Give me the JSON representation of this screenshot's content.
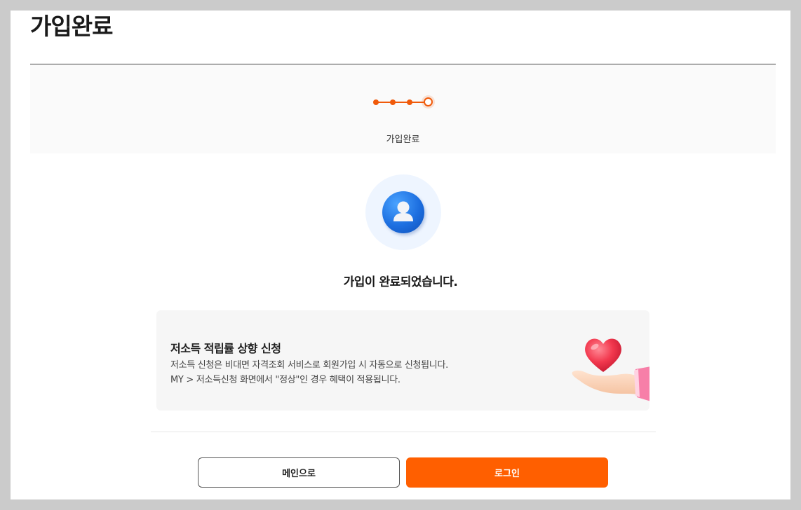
{
  "page": {
    "title": "가입완료"
  },
  "stepper": {
    "total_steps": 4,
    "current_step": 4,
    "current_label": "가입완료",
    "accent_color": "#f05a0a"
  },
  "result": {
    "icon": "user-avatar-icon",
    "message": "가입이 완료되었습니다."
  },
  "info_card": {
    "title": "저소득 적립률 상향 신청",
    "line1": "저소득 신청은 비대면 자격조회 서비스로 회원가입 시 자동으로 신청됩니다.",
    "line2": "MY > 저소득신청 화면에서 \"정상\"인 경우 혜택이 적용됩니다.",
    "illustration": "hand-holding-heart-icon"
  },
  "buttons": {
    "main_label": "메인으로",
    "login_label": "로그인",
    "login_color": "#ff5f00"
  }
}
